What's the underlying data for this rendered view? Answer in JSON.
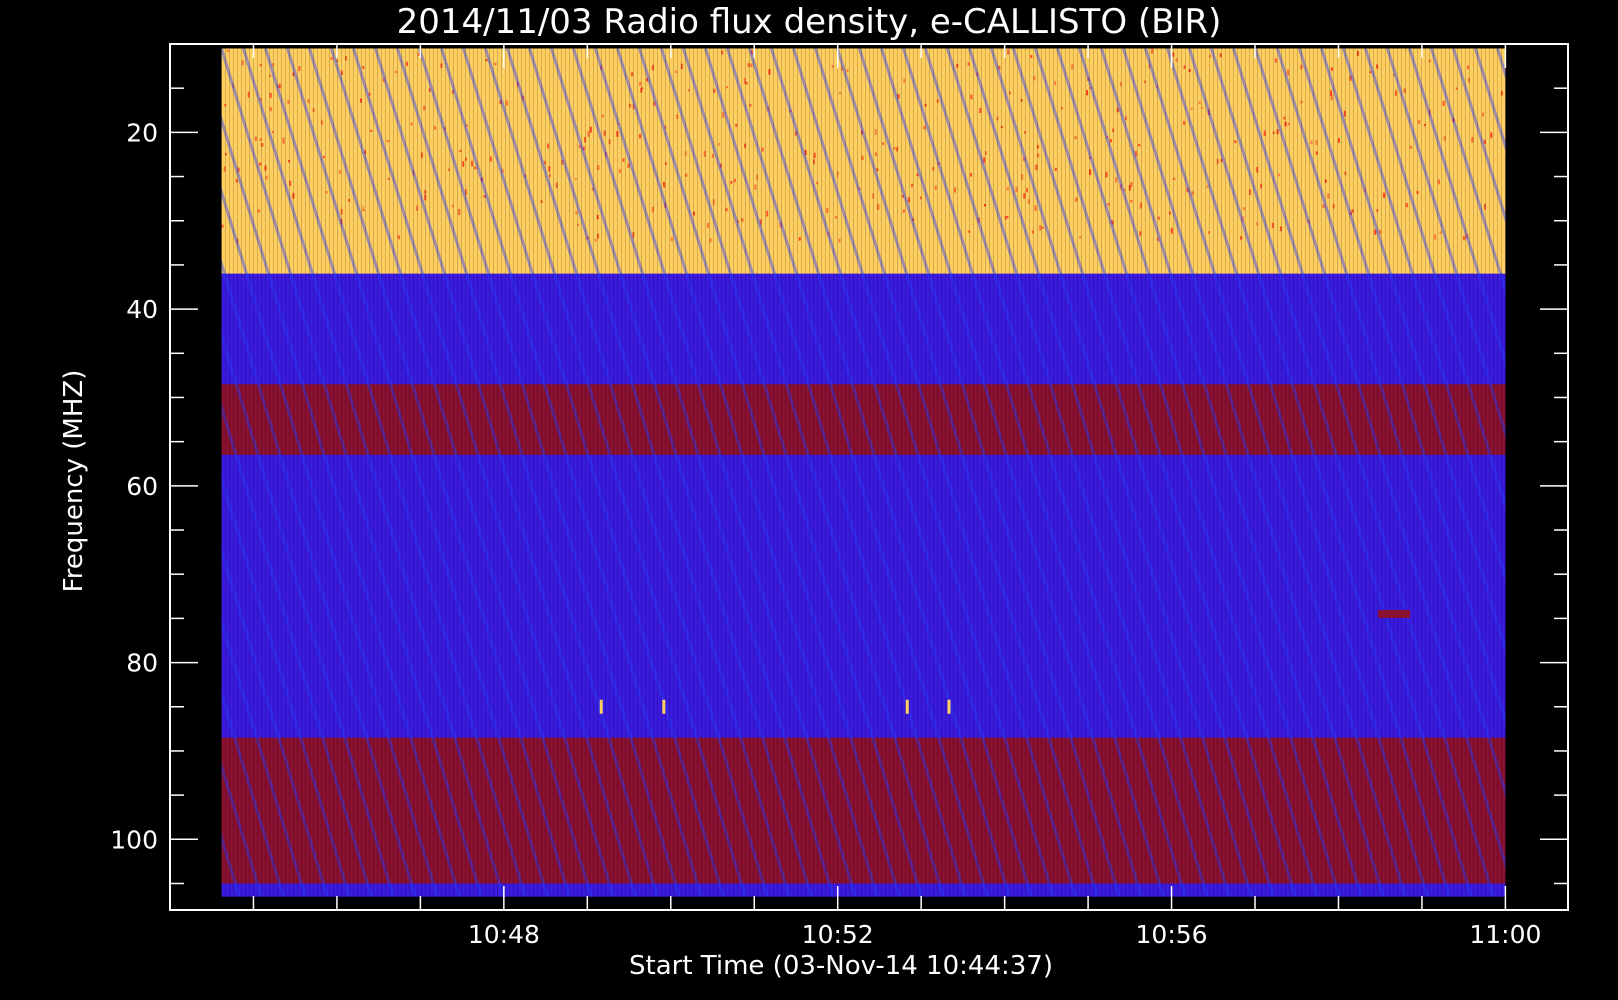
{
  "chart_data": {
    "type": "heatmap",
    "title": "2014/11/03  Radio flux density, e-CALLISTO (BIR)",
    "xlabel": "Start Time (03-Nov-14 10:44:37)",
    "ylabel": "Frequency (MHZ)",
    "x_range": [
      "10:44:37",
      "11:00:00"
    ],
    "xlim": [
      "10:44:00",
      "11:00:45"
    ],
    "ylim": [
      10,
      108
    ],
    "y_inverted": true,
    "x_ticks": [
      {
        "t": "10:48",
        "label": "10:48"
      },
      {
        "t": "10:52",
        "label": "10:52"
      },
      {
        "t": "10:56",
        "label": "10:56"
      },
      {
        "t": "11:00",
        "label": "11:00"
      }
    ],
    "x_minor_ticks": [
      "10:45",
      "10:46",
      "10:47",
      "10:49",
      "10:50",
      "10:51",
      "10:53",
      "10:54",
      "10:55",
      "10:57",
      "10:58",
      "10:59"
    ],
    "y_ticks": [
      {
        "v": 20,
        "label": "20"
      },
      {
        "v": 40,
        "label": "40"
      },
      {
        "v": 60,
        "label": "60"
      },
      {
        "v": 80,
        "label": "80"
      },
      {
        "v": 100,
        "label": "100"
      }
    ],
    "y_minor_ticks": [
      15,
      25,
      30,
      35,
      45,
      50,
      55,
      65,
      70,
      75,
      85,
      90,
      95,
      105
    ],
    "bands": [
      {
        "f0": 10.5,
        "f1": 36,
        "level": "high"
      },
      {
        "f0": 36,
        "f1": 48.5,
        "level": "low"
      },
      {
        "f0": 48.5,
        "f1": 56.5,
        "level": "medium"
      },
      {
        "f0": 56.5,
        "f1": 88.5,
        "level": "low"
      },
      {
        "f0": 88.5,
        "f1": 105,
        "level": "medium"
      },
      {
        "f0": 105,
        "f1": 106.5,
        "level": "low"
      }
    ],
    "spots": [
      {
        "t": "10:49:10",
        "f": 85,
        "level": "high"
      },
      {
        "t": "10:49:55",
        "f": 85,
        "level": "high"
      },
      {
        "t": "10:52:50",
        "f": 85,
        "level": "high"
      },
      {
        "t": "10:53:20",
        "f": 85,
        "level": "high"
      },
      {
        "t": "10:58:40",
        "f": 74.5,
        "level": "medium"
      }
    ],
    "colors": {
      "background": "#000000",
      "low": "#3a1ae0",
      "medium": "#8a1030",
      "high": "#ffd060",
      "stripe": "#2a3cff",
      "axis": "#ffffff"
    }
  }
}
